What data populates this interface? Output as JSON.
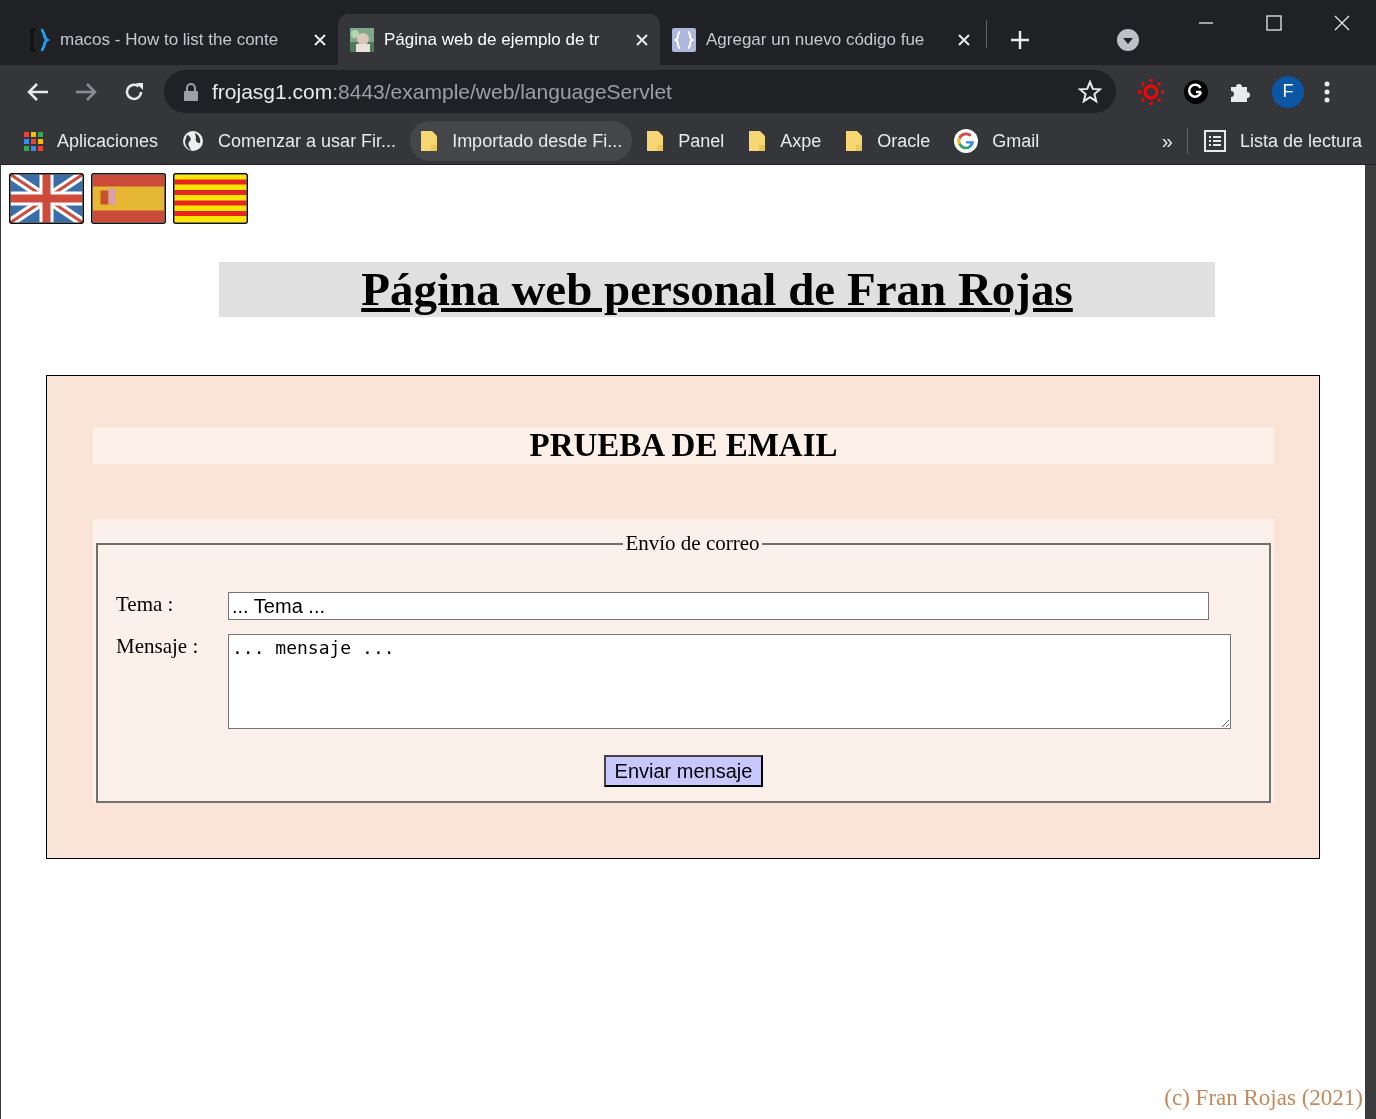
{
  "tabs": [
    {
      "title": "macos - How to list the conte",
      "kind": "braces",
      "selected": false
    },
    {
      "title": "Página web de ejemplo de tr",
      "selected": true
    },
    {
      "title": "Agregar un nuevo código fue",
      "kind": "boxed",
      "selected": false
    }
  ],
  "address": {
    "host": "frojasg1.com",
    "path": ":8443/example/web/languageServlet"
  },
  "profile_initial": "F",
  "bookmarks": [
    {
      "label": "Aplicaciones",
      "kind": "apps",
      "hovered": false
    },
    {
      "label": "Comenzar a usar Fir...",
      "kind": "globe",
      "hovered": false
    },
    {
      "label": "Importado desde Fi...",
      "kind": "folder",
      "hovered": true
    },
    {
      "label": "Panel",
      "kind": "folder",
      "hovered": false
    },
    {
      "label": "Axpe",
      "kind": "folder",
      "hovered": false
    },
    {
      "label": "Oracle",
      "kind": "folder",
      "hovered": false
    },
    {
      "label": "Gmail",
      "kind": "google",
      "hovered": false
    }
  ],
  "bookmarks_overflow": "»",
  "reading_list": "Lista de lectura",
  "page": {
    "flags": [
      {
        "kind": "uk"
      },
      {
        "kind": "es"
      },
      {
        "kind": "cat"
      }
    ],
    "title": "Página web personal de Fran Rojas",
    "section_title": "PRUEBA DE EMAIL",
    "legend": "Envío de correo",
    "fields": [
      {
        "label": "Tema :",
        "kind": "input",
        "value": "... Tema ..."
      },
      {
        "label": "Mensaje :",
        "kind": "textarea",
        "value": "... mensaje ..."
      }
    ],
    "submit": "Enviar mensaje",
    "footer": "(c) Fran Rojas (2021)"
  }
}
